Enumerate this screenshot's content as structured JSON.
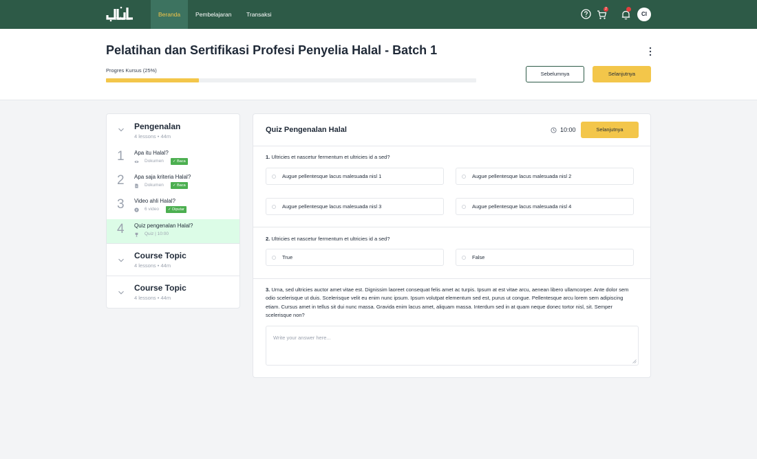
{
  "nav": {
    "logo_text": "halal-in",
    "links": [
      {
        "label": "Beranda",
        "active": true
      },
      {
        "label": "Pembelajaran",
        "active": false
      },
      {
        "label": "Transaksi",
        "active": false
      }
    ],
    "cart_badge": "2",
    "avatar_initials": "CI",
    "colors": {
      "bg": "#2d5a47",
      "active_bg": "#3d7360",
      "active_text": "#f3c64a"
    },
    "icons": [
      "help-icon",
      "cart-icon",
      "bell-icon"
    ]
  },
  "header": {
    "title": "Pelatihan dan Sertifikasi Profesi Penyelia Halal - Batch 1",
    "progress_label": "Progres Kursus (25%)",
    "progress_percent": 25,
    "prev_label": "Sebelumnya",
    "next_label": "Selanjutnya"
  },
  "sidebar": {
    "sections": [
      {
        "title": "Pengenalan",
        "meta": "4 lessons • 44m",
        "expanded": true,
        "lessons": [
          {
            "num": "1",
            "title": "Apa itu Halal?",
            "type": "Dokumen",
            "icon": "eye-icon",
            "badge": "✓ Baca"
          },
          {
            "num": "2",
            "title": "Apa saja kriteria Halal?",
            "type": "Dokumen",
            "icon": "document-icon",
            "badge": "✓ Baca"
          },
          {
            "num": "3",
            "title": "Video ahli Halal?",
            "type": "6 video",
            "icon": "play-icon",
            "badge": "✓ Diputar"
          },
          {
            "num": "4",
            "title": "Quiz pengenalan Halal?",
            "type": "Quiz | 10:00",
            "icon": "trophy-icon",
            "badge": "",
            "active": true
          }
        ]
      },
      {
        "title": "Course Topic",
        "meta": "4 lessons • 44m",
        "expanded": false
      },
      {
        "title": "Course Topic",
        "meta": "4 lessons • 44m",
        "expanded": false
      }
    ]
  },
  "quiz": {
    "title": "Quiz Pengenalan Halal",
    "timer": "10:00",
    "next_label": "Selanjutnya",
    "questions": [
      {
        "num": "1.",
        "text": "Ultricies et nascetur fermentum et ultricies id a sed?",
        "options": [
          "Augue pellentesque lacus malesuada nisl 1",
          "Augue pellentesque lacus malesuada nisl 2",
          "Augue pellentesque lacus malesuada nisl 3",
          "Augue pellentesque lacus malesuada nisl 4"
        ]
      },
      {
        "num": "2.",
        "text": "Ultricies et nascetur fermentum et ultricies id a sed?",
        "options": [
          "True",
          "False"
        ]
      },
      {
        "num": "3.",
        "text": "Urna, sed ultricies auctor amet vitae est. Dignissim laoreet consequat felis amet ac turpis. Ipsum at est vitae arcu, aenean libero ullamcorper. Ante dolor sem odio scelerisque ut duis. Scelerisque velit eu enim nunc ipsum. Ipsum volutpat elementum sed est, purus ut congue. Pellentesque arcu lorem sem adipiscing etiam. Cursus amet in tellus sit dui nunc massa. Gravida enim lacus amet, aliquam massa. Interdum sed in at quam neque donec tortor nisl, sit. Semper scelerisque non?",
        "placeholder": "Write your answer here..."
      }
    ]
  },
  "colors": {
    "accent": "#f3c64a",
    "brand": "#2d5a47",
    "success": "#4caf50",
    "active_lesson_bg": "#dcfce7"
  }
}
